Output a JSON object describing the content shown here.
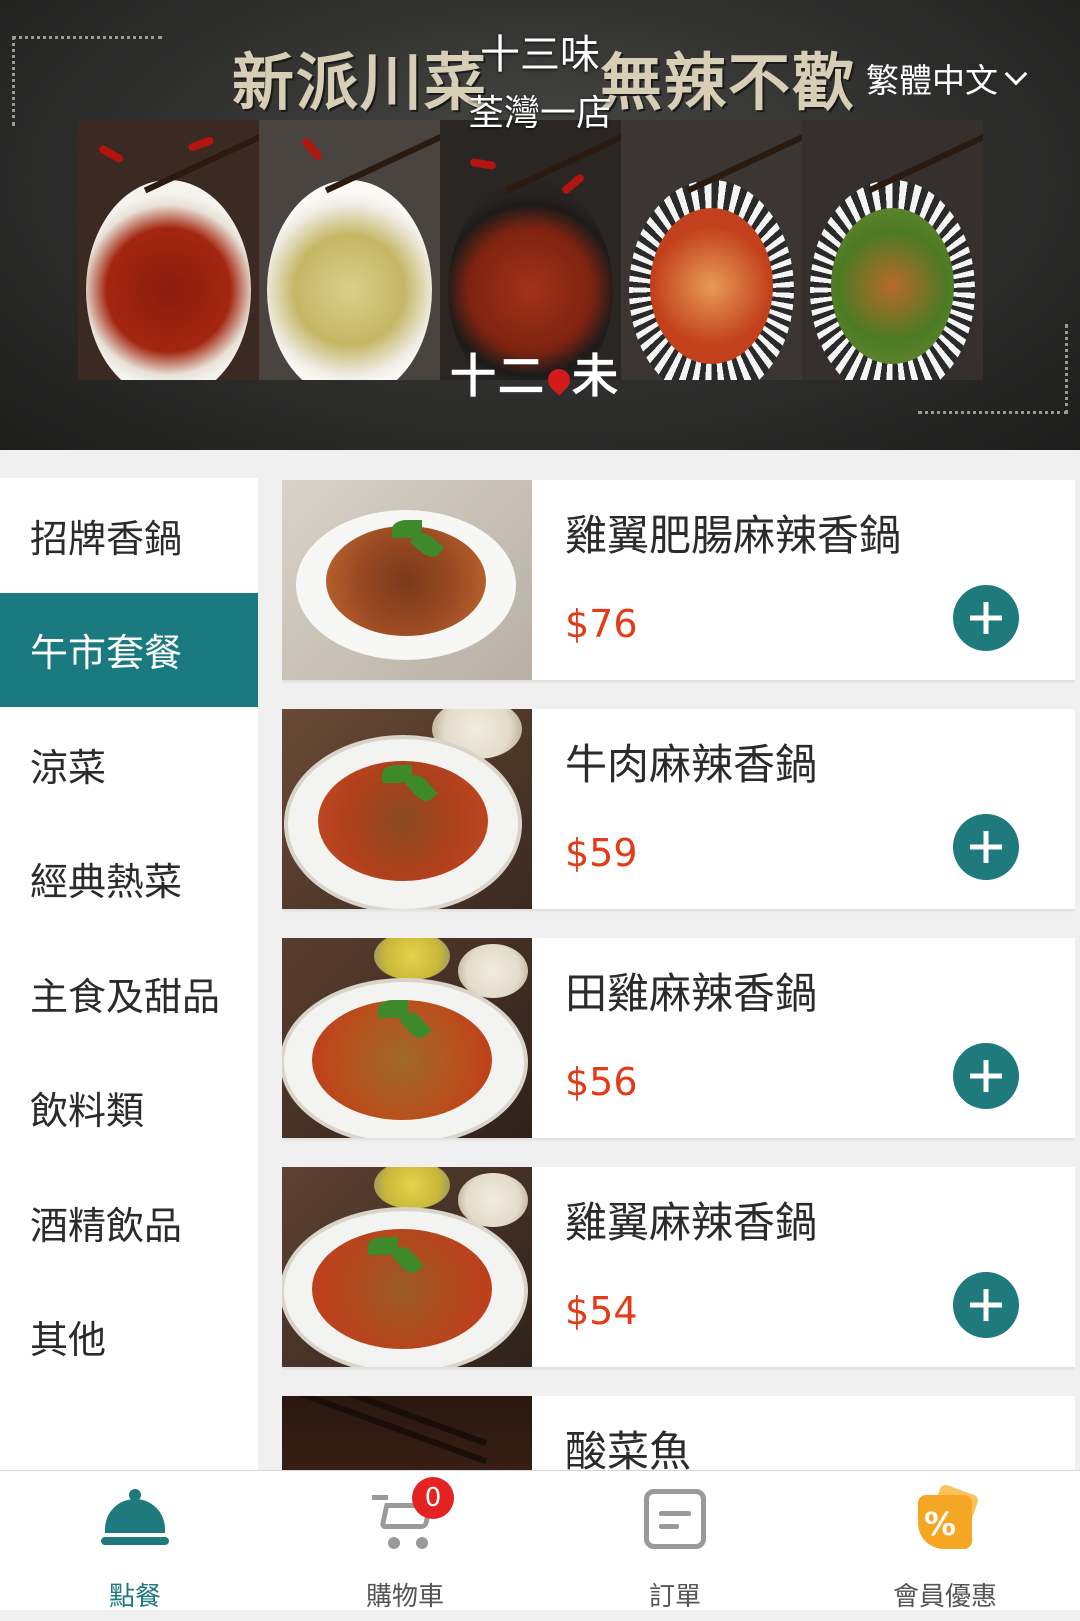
{
  "header": {
    "slogan_left": "新派川菜",
    "slogan_right": "無辣不歡",
    "store_name": "十三味",
    "branch": "荃灣一店",
    "language": "繁體中文",
    "logo_text_a": "十二",
    "logo_text_b": "未"
  },
  "categories": [
    {
      "label": "招牌香鍋",
      "active": false
    },
    {
      "label": "午市套餐",
      "active": true
    },
    {
      "label": "涼菜",
      "active": false
    },
    {
      "label": "經典熱菜",
      "active": false
    },
    {
      "label": "主食及甜品",
      "active": false
    },
    {
      "label": "飲料類",
      "active": false
    },
    {
      "label": "酒精飲品",
      "active": false
    },
    {
      "label": "其他",
      "active": false
    }
  ],
  "items": [
    {
      "name": "雞翼肥腸麻辣香鍋",
      "price": "$76"
    },
    {
      "name": "牛肉麻辣香鍋",
      "price": "$59"
    },
    {
      "name": "田雞麻辣香鍋",
      "price": "$56"
    },
    {
      "name": "雞翼麻辣香鍋",
      "price": "$54"
    },
    {
      "name": "酸菜魚",
      "price": ""
    }
  ],
  "nav": {
    "order": "點餐",
    "cart": "購物車",
    "cart_count": "0",
    "orders": "訂單",
    "member": "會員優惠"
  },
  "colors": {
    "accent": "#1f7a7d",
    "price": "#e53a17",
    "badge": "#e52222",
    "member_icon": "#f5a623"
  }
}
